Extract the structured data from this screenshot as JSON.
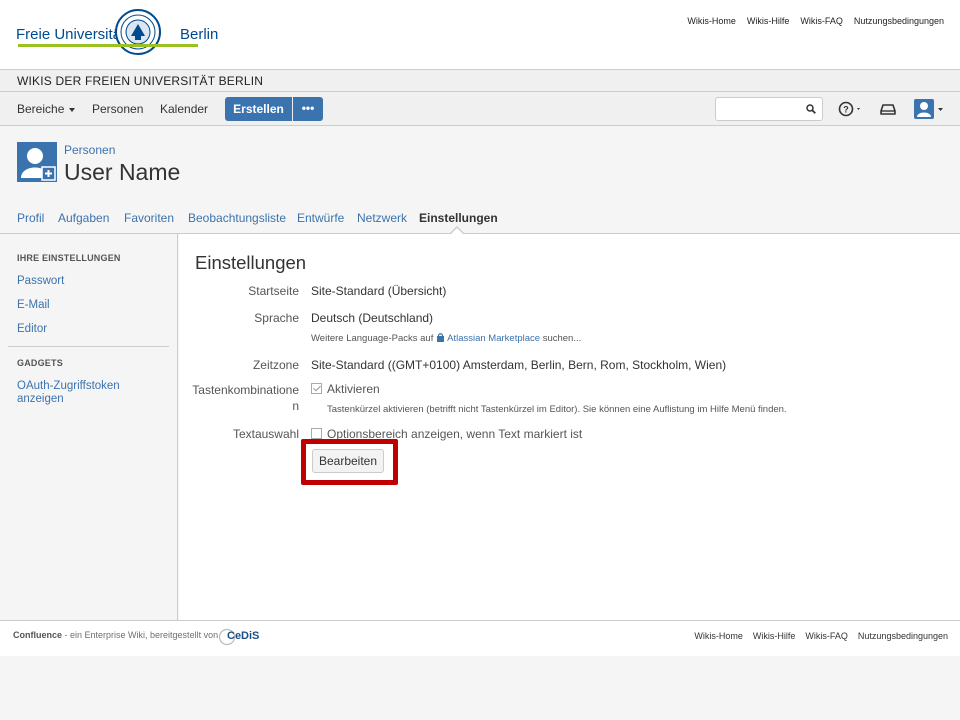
{
  "university": {
    "name_left": "Freie Universität",
    "name_right": "Berlin",
    "top_links": [
      "Wikis-Home",
      "Wikis-Hilfe",
      "Wikis-FAQ",
      "Nutzungsbedingungen"
    ]
  },
  "site_title": "WIKIS DER FREIEN UNIVERSITÄT BERLIN",
  "nav": {
    "bereiche": "Bereiche",
    "personen": "Personen",
    "kalender": "Kalender",
    "create": "Erstellen",
    "more": "•••",
    "search_placeholder": ""
  },
  "header": {
    "breadcrumb": "Personen",
    "title": "User Name"
  },
  "tabs": [
    {
      "label": "Profil",
      "active": false
    },
    {
      "label": "Aufgaben",
      "active": false
    },
    {
      "label": "Favoriten",
      "active": false
    },
    {
      "label": "Beobachtungsliste",
      "active": false
    },
    {
      "label": "Entwürfe",
      "active": false
    },
    {
      "label": "Netzwerk",
      "active": false
    },
    {
      "label": "Einstellungen",
      "active": true
    }
  ],
  "sidebar": {
    "settings_heading": "IHRE EINSTELLUNGEN",
    "settings_links": [
      "Passwort",
      "E-Mail",
      "Editor"
    ],
    "gadgets_heading": "GADGETS",
    "gadget_link": "OAuth-Zugriffstoken anzeigen"
  },
  "settings": {
    "title": "Einstellungen",
    "startseite_label": "Startseite",
    "startseite_value": "Site-Standard (Übersicht)",
    "sprache_label": "Sprache",
    "sprache_value": "Deutsch (Deutschland)",
    "sprache_hint_pre": "Weitere Language-Packs auf",
    "sprache_hint_link": "Atlassian Marketplace",
    "sprache_hint_post": "suchen...",
    "zeitzone_label": "Zeitzone",
    "zeitzone_value": "Site-Standard ((GMT+0100) Amsterdam, Berlin, Bern, Rom, Stockholm, Wien)",
    "tasten_label_1": "Tastenkombinatione",
    "tasten_label_2": "n",
    "tasten_value": "Aktivieren",
    "tasten_checked": true,
    "tasten_hint": "Tastenkürzel aktivieren (betrifft nicht Tastenkürzel im Editor). Sie können eine Auflistung im Hilfe Menü finden.",
    "textauswahl_label": "Textauswahl",
    "textauswahl_value": "Optionsbereich anzeigen, wenn Text markiert ist",
    "textauswahl_checked": false,
    "edit_button": "Bearbeiten"
  },
  "footer": {
    "product": "Confluence",
    "tagline": " - ein Enterprise Wiki, bereitgestellt von",
    "provider": "CeDiS",
    "links": [
      "Wikis-Home",
      "Wikis-Hilfe",
      "Wikis-FAQ",
      "Nutzungsbedingungen"
    ]
  },
  "colors": {
    "accent": "#3b73af",
    "highlight": "#c00000",
    "fu_blue": "#004b8d",
    "fu_green": "#99c222"
  }
}
